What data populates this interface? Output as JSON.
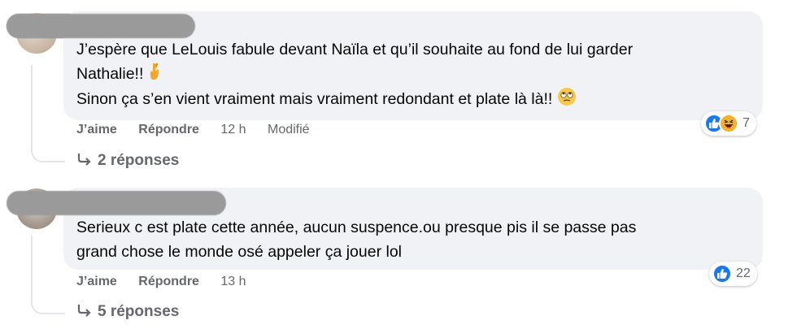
{
  "comments": [
    {
      "lines": [
        "J’espère que LeLouis fabule devant Naïla et qu’il souhaite au fond de lui garder",
        "Nathalie!! ",
        "Sinon ça s’en vient vraiment mais vraiment redondant et plate là là!! "
      ],
      "actions": {
        "like": "J’aime",
        "reply": "Répondre",
        "time": "12 h",
        "edited": "Modifié"
      },
      "reaction_count": "7",
      "replies": "2 réponses"
    },
    {
      "lines": [
        "Serieux c est plate cette année, aucun suspence.ou presque pis il se passe pas",
        "grand chose le monde osé appeler ça jouer lol"
      ],
      "actions": {
        "like": "J’aime",
        "reply": "Répondre",
        "time": "13 h"
      },
      "reaction_count": "22",
      "replies": "5 réponses"
    }
  ]
}
